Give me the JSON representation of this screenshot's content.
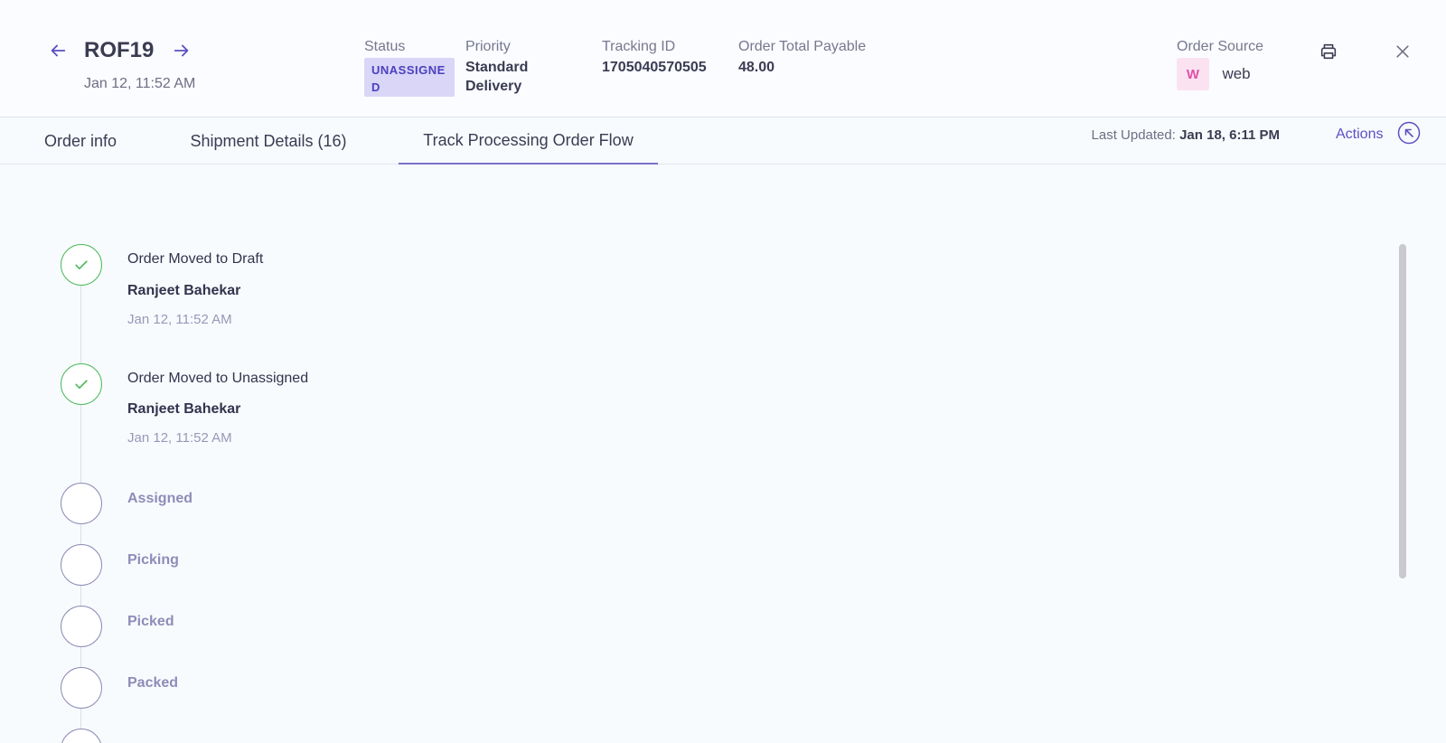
{
  "header": {
    "order_id": "ROF19",
    "order_date": "Jan 12, 11:52 AM",
    "status_label": "Status",
    "status_value": "UNASSIGNED",
    "priority_label": "Priority",
    "priority_value": "Standard Delivery",
    "tracking_label": "Tracking ID",
    "tracking_value": "1705040570505",
    "total_label": "Order Total Payable",
    "total_value": "48.00",
    "source_label": "Order Source",
    "source_badge": "W",
    "source_value": "web",
    "icons": {
      "prev": "arrow-left-icon",
      "next": "arrow-right-icon",
      "print": "printer-icon",
      "close": "close-icon"
    }
  },
  "tabs": [
    {
      "label": "Order info",
      "active": false
    },
    {
      "label": "Shipment Details (16)",
      "active": false
    },
    {
      "label": "Track Processing Order Flow",
      "active": true
    }
  ],
  "toolbar": {
    "last_updated_label": "Last Updated:",
    "last_updated_value": "Jan 18, 6:11 PM",
    "actions_label": "Actions",
    "actions_icon": "arrow-up-left-circle-icon"
  },
  "timeline": {
    "completed": [
      {
        "title": "Order Moved to Draft",
        "user": "Ranjeet Bahekar",
        "time": "Jan 12, 11:52 AM"
      },
      {
        "title": "Order Moved to Unassigned",
        "user": "Ranjeet Bahekar",
        "time": "Jan 12, 11:52 AM"
      }
    ],
    "pending": [
      {
        "label": "Assigned"
      },
      {
        "label": "Picking"
      },
      {
        "label": "Picked"
      },
      {
        "label": "Packed"
      }
    ]
  },
  "colors": {
    "accent": "#5d4fc4",
    "done": "#4dbb5c",
    "pending": "#8e8cb5",
    "status_bg": "#d9d6f7"
  }
}
